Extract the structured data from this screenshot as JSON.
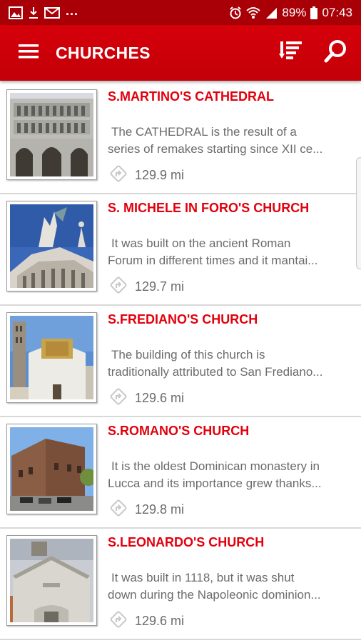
{
  "status_bar": {
    "battery": "89%",
    "time": "07:43",
    "more": "..."
  },
  "app_bar": {
    "title": "CHURCHES"
  },
  "items": [
    {
      "title": "S.MARTINO'S CATHEDRAL",
      "desc_line1": "The CATHEDRAL is the result of a",
      "desc_line2": "series of remakes starting since XII ce...",
      "distance": "129.9 mi"
    },
    {
      "title": "S. MICHELE IN FORO'S CHURCH",
      "desc_line1": "It was built on the ancient Roman",
      "desc_line2": "Forum in different times and it mantai...",
      "distance": "129.7 mi"
    },
    {
      "title": "S.FREDIANO'S CHURCH",
      "desc_line1": "The building of this church is",
      "desc_line2": "traditionally attributed to San Frediano...",
      "distance": "129.6 mi"
    },
    {
      "title": "S.ROMANO'S CHURCH",
      "desc_line1": "It is the oldest Dominican monastery in",
      "desc_line2": "Lucca and its importance grew thanks...",
      "distance": "129.8 mi"
    },
    {
      "title": "S.LEONARDO'S CHURCH",
      "desc_line1": "It was built in 1118, but it was shut",
      "desc_line2": "down during the Napoleonic dominion...",
      "distance": "129.6 mi"
    }
  ],
  "colors": {
    "status_bar": "#a80006",
    "app_bar": "#d6000a",
    "title_red": "#e2000d",
    "text_gray": "#6b6b6b"
  }
}
